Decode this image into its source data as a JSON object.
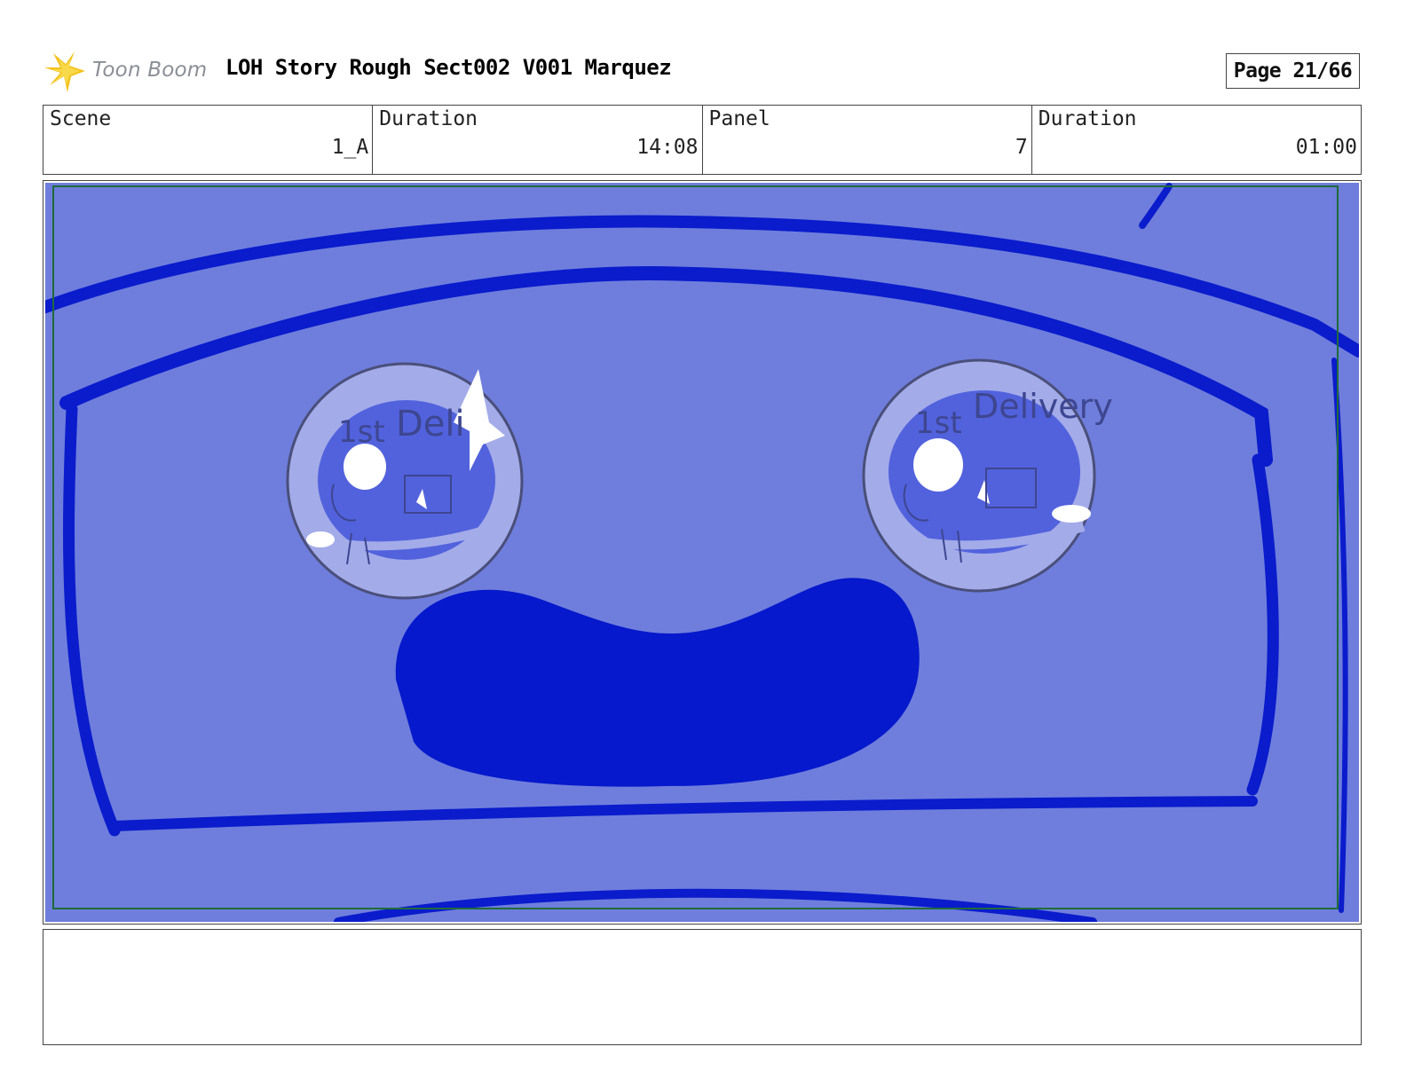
{
  "header": {
    "logo_text": "Toon Boom",
    "title": "LOH Story Rough Sect002 V001 Marquez",
    "page": "Page 21/66"
  },
  "info": {
    "scene_label": "Scene",
    "scene_value": "1_A",
    "scene_duration_label": "Duration",
    "scene_duration_value": "14:08",
    "panel_label": "Panel",
    "panel_value": "7",
    "panel_duration_label": "Duration",
    "panel_duration_value": "01:00"
  },
  "panel": {
    "eye_left_text_1": "1st",
    "eye_left_text_2": "Deli",
    "eye_right_text_1": "1st",
    "eye_right_text_2": "Delivery",
    "colors": {
      "background": "#6f7edc",
      "line": "#0a1ccc",
      "mouth": "#0619cc",
      "eye_outer": "#a3abe9",
      "eye_inner": "#5262dd",
      "highlight": "#ffffff",
      "safe_frame": "#1e6b3a"
    }
  },
  "notes": {}
}
